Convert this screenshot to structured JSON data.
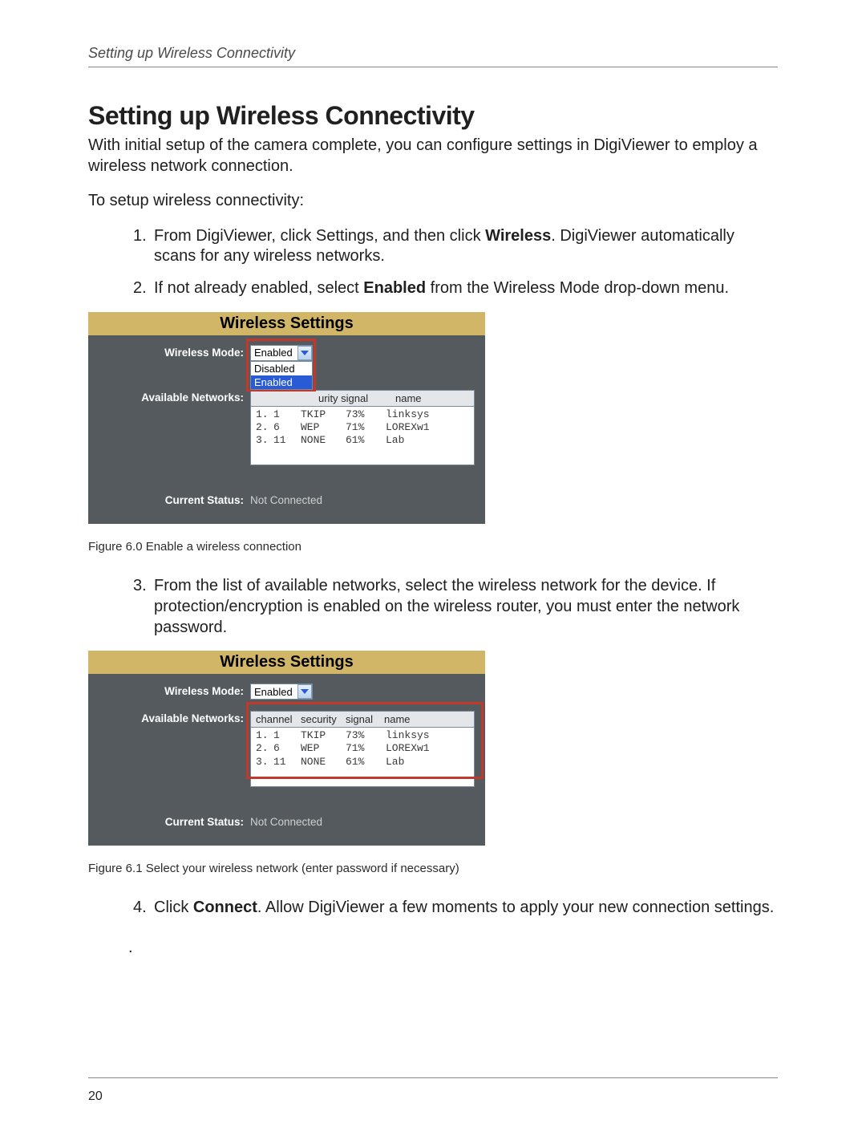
{
  "header": {
    "running_head": "Setting up Wireless Connectivity"
  },
  "heading": "Setting up Wireless Connectivity",
  "intro": "With initial setup of the camera complete, you can configure settings in DigiViewer to employ a wireless network connection.",
  "lead_in": "To setup wireless connectivity:",
  "steps": {
    "s1_pre": "1.",
    "s1a": "From DigiViewer, click Settings, and then click ",
    "s1_bold": "Wireless",
    "s1b": ". DigiViewer automatically scans for any wireless networks.",
    "s2_pre": "2.",
    "s2a": "If not already enabled, select ",
    "s2_bold": "Enabled",
    "s2b": " from the Wireless Mode drop-down menu.",
    "s3_pre": "3.",
    "s3": "From the list of available networks, select the wireless network for the device. If protection/encryption is enabled on the wireless router, you must enter the network password.",
    "s4_pre": "4.",
    "s4a": "Click ",
    "s4_bold": "Connect",
    "s4b": ". Allow DigiViewer a few moments to apply your new connection settings."
  },
  "panel": {
    "title": "Wireless Settings",
    "mode_label": "Wireless Mode:",
    "networks_label": "Available Networks:",
    "status_label": "Current Status:",
    "status_value": "Not Connected",
    "mode_value": "Enabled",
    "mode_options": {
      "disabled": "Disabled",
      "enabled": "Enabled"
    },
    "list_header": {
      "channel": "channel",
      "security": "security",
      "signal": "signal",
      "name": "name"
    },
    "list_header_partial": {
      "urity_signal": "urity signal",
      "name": "name"
    },
    "rows": [
      {
        "idx": "1.",
        "ch": "1",
        "sec": "TKIP",
        "sig": "73%",
        "name": "linksys"
      },
      {
        "idx": "2.",
        "ch": "6",
        "sec": "WEP",
        "sig": "71%",
        "name": "LOREXw1"
      },
      {
        "idx": "3.",
        "ch": "11",
        "sec": "NONE",
        "sig": "61%",
        "name": "Lab"
      }
    ]
  },
  "captions": {
    "fig60": "Figure 6.0 Enable a wireless connection",
    "fig61": "Figure 6.1 Select your wireless network (enter password if necessary)"
  },
  "footer": {
    "page": "20",
    "dot": "."
  }
}
